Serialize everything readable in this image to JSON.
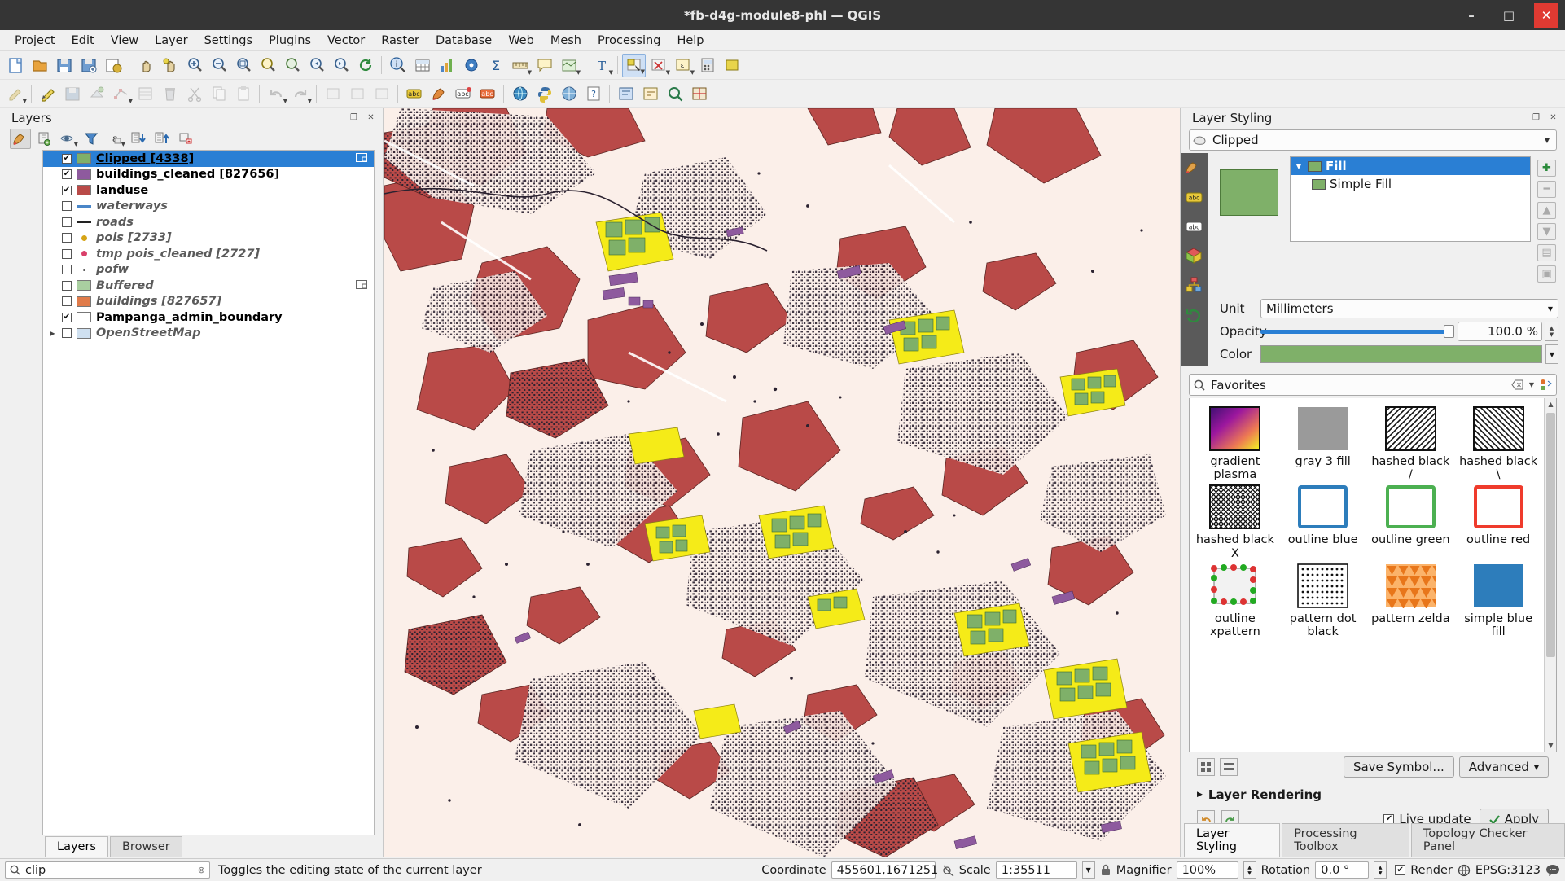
{
  "window": {
    "title": "*fb-d4g-module8-phl — QGIS",
    "minimize": "–",
    "maximize": "□",
    "close": "✕"
  },
  "menubar": {
    "items": [
      "Project",
      "Edit",
      "View",
      "Layer",
      "Settings",
      "Plugins",
      "Vector",
      "Raster",
      "Database",
      "Web",
      "Mesh",
      "Processing",
      "Help"
    ]
  },
  "toolbar_icons": {
    "row1": [
      "new-project-icon",
      "open-project-icon",
      "save-project-icon",
      "save-project-as-icon",
      "project-properties-icon",
      "pan-map-icon",
      "pan-to-selection-icon",
      "zoom-in-icon",
      "zoom-out-icon",
      "zoom-full-icon",
      "zoom-to-selection-icon",
      "zoom-to-layer-icon",
      "zoom-last-icon",
      "zoom-next-icon",
      "refresh-icon",
      "identify-features-icon",
      "open-attribute-table-icon",
      "statistical-summary-icon",
      "processing-toolbox-icon",
      "sum-field-icon",
      "measure-line-icon",
      "show-map-tips-icon",
      "new-map-view-icon",
      "new-text-annotation-icon",
      "select-features-icon",
      "deselect-features-icon",
      "select-by-expression-icon",
      "open-field-calculator-icon",
      "new-bookmark-icon"
    ],
    "row2": [
      "current-edits-icon",
      "toggle-editing-icon",
      "save-layer-edits-icon",
      "add-feature-icon",
      "vertex-tool-icon",
      "modify-attributes-icon",
      "delete-selected-icon",
      "cut-features-icon",
      "copy-features-icon",
      "paste-features-icon",
      "undo-icon",
      "redo-icon",
      "label-toolbar-icon",
      "style-manager-icon",
      "pin-labels-icon",
      "show-hide-labels-icon",
      "globe-plugin-icon",
      "python-console-icon",
      "web-browser-icon",
      "help-icon",
      "metasearch-icon",
      "qgis2web-icon",
      "plugin-search-icon",
      "georeferencer-icon"
    ]
  },
  "layers_panel": {
    "title": "Layers",
    "toolbar": [
      "open-layer-styling-panel-icon",
      "add-group-icon",
      "manage-layer-visibility-icon",
      "filter-legend-icon",
      "filter-legend-by-expression-icon",
      "expand-all-icon",
      "collapse-all-icon",
      "remove-layer-icon"
    ],
    "items": [
      {
        "name": "Clipped [4338]",
        "checked": true,
        "selected": true,
        "symbol": "polygon",
        "color": "#7fb069",
        "bold": true
      },
      {
        "name": "buildings_cleaned [827656]",
        "checked": true,
        "selected": false,
        "symbol": "polygon",
        "color": "#8e5a9e",
        "bold": true
      },
      {
        "name": "landuse",
        "checked": true,
        "selected": false,
        "symbol": "polygon",
        "color": "#b94a48",
        "bold": true
      },
      {
        "name": "waterways",
        "checked": false,
        "selected": false,
        "symbol": "line",
        "color": "#4a86c8",
        "bold": false
      },
      {
        "name": "roads",
        "checked": false,
        "selected": false,
        "symbol": "line",
        "color": "#222222",
        "bold": false
      },
      {
        "name": "pois [2733]",
        "checked": false,
        "selected": false,
        "symbol": "point",
        "color": "#d6a416",
        "bold": false
      },
      {
        "name": "tmp pois_cleaned [2727]",
        "checked": false,
        "selected": false,
        "symbol": "point",
        "color": "#d9406a",
        "bold": false
      },
      {
        "name": "pofw",
        "checked": false,
        "selected": false,
        "symbol": "dot",
        "color": "#555555",
        "bold": false
      },
      {
        "name": "Buffered",
        "checked": false,
        "selected": false,
        "symbol": "polygon",
        "color": "#a9cfa0",
        "bold": false
      },
      {
        "name": "buildings [827657]",
        "checked": false,
        "selected": false,
        "symbol": "polygon",
        "color": "#e07b4a",
        "bold": false
      },
      {
        "name": "Pampanga_admin_boundary",
        "checked": true,
        "selected": false,
        "symbol": "polygon",
        "color": "#ffffff",
        "bold": true
      },
      {
        "name": "OpenStreetMap",
        "checked": false,
        "selected": false,
        "symbol": "polygon",
        "color": "#cfe0f0",
        "bold": false,
        "expandable": true
      }
    ],
    "tabs": [
      {
        "label": "Layers",
        "active": true
      },
      {
        "label": "Browser",
        "active": false
      }
    ]
  },
  "layer_styling": {
    "title": "Layer Styling",
    "layer_selector": "Clipped",
    "renderer": "Single Symbol",
    "vtabs": [
      "labels-icon",
      "masks-icon",
      "3d-view-icon",
      "diagrams-icon",
      "symbology-icon",
      "history-icon"
    ],
    "symbol_tree": [
      {
        "label": "Fill",
        "selected": true,
        "color": "#7fb069",
        "level": 0
      },
      {
        "label": "Simple Fill",
        "selected": false,
        "color": "#7fb069",
        "level": 1
      }
    ],
    "tree_buttons": [
      "add-symbol-layer-icon",
      "remove-symbol-layer-icon",
      "duplicate-symbol-layer-icon",
      "move-symbol-layer-up-icon",
      "move-symbol-layer-down-icon",
      "lock-symbol-layer-icon"
    ],
    "properties": {
      "unit_label": "Unit",
      "unit_value": "Millimeters",
      "opacity_label": "Opacity",
      "opacity_value": "100.0 %",
      "color_label": "Color",
      "color_value": "#7fb069"
    },
    "browser": {
      "search_value": "Favorites",
      "symbols": [
        {
          "label": "gradient plasma",
          "kind": "gradient"
        },
        {
          "label": "gray 3 fill",
          "kind": "gray"
        },
        {
          "label": "hashed black /",
          "kind": "hatch-fwd"
        },
        {
          "label": "hashed black \\",
          "kind": "hatch-back"
        },
        {
          "label": "hashed black X",
          "kind": "hatch-x"
        },
        {
          "label": "outline blue",
          "kind": "outline",
          "color": "#2d7dbb"
        },
        {
          "label": "outline green",
          "kind": "outline",
          "color": "#4cb051"
        },
        {
          "label": "outline red",
          "kind": "outline",
          "color": "#ef3b2c"
        },
        {
          "label": "outline xpattern",
          "kind": "xpattern"
        },
        {
          "label": "pattern dot black",
          "kind": "dots"
        },
        {
          "label": "pattern zelda",
          "kind": "zelda"
        },
        {
          "label": "simple blue fill",
          "kind": "solid",
          "color": "#2d7dbb"
        }
      ],
      "save_symbol_label": "Save Symbol...",
      "advanced_label": "Advanced",
      "view_icons": [
        "grid-view-icon",
        "list-view-icon"
      ]
    },
    "layer_rendering_label": "Layer Rendering",
    "live_update_label": "Live update",
    "live_update_checked": true,
    "apply_label": "Apply",
    "undo_icon": "undo-icon",
    "redo_icon": "redo-icon",
    "tabs": [
      {
        "label": "Layer Styling",
        "active": true
      },
      {
        "label": "Processing Toolbox",
        "active": false
      },
      {
        "label": "Topology Checker Panel",
        "active": false
      }
    ]
  },
  "statusbar": {
    "locator_value": "clip",
    "locator_clear_icon": "clear-icon",
    "message": "Toggles the editing state of the current layer",
    "coordinate_label": "Coordinate",
    "coordinate_value": "455601,1671251",
    "toggle_extents_icon": "toggle-extents-icon",
    "scale_label": "Scale",
    "scale_value": "1:35511",
    "lock_icon": "lock-icon",
    "magnifier_label": "Magnifier",
    "magnifier_value": "100%",
    "rotation_label": "Rotation",
    "rotation_value": "0.0 °",
    "render_label": "Render",
    "render_checked": true,
    "crs_value": "EPSG:3123",
    "messages_icon": "messages-icon"
  }
}
